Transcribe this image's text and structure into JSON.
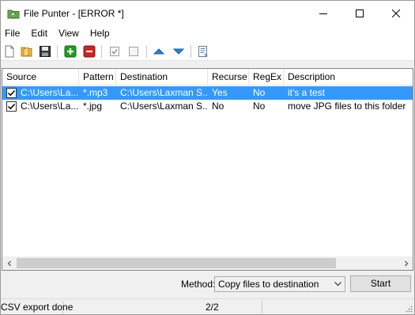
{
  "window": {
    "title": "File Punter - [ERROR *]"
  },
  "menu": {
    "items": [
      "File",
      "Edit",
      "View",
      "Help"
    ]
  },
  "toolbar": {
    "icons": [
      "new-icon",
      "open-icon",
      "save-icon",
      "add-icon",
      "remove-icon",
      "check-all-icon",
      "uncheck-all-icon",
      "move-up-icon",
      "move-down-icon",
      "export-icon"
    ]
  },
  "list": {
    "columns": [
      "Source",
      "Pattern",
      "Destination",
      "Recurse",
      "RegEx",
      "Description"
    ],
    "rows": [
      {
        "checked": true,
        "selected": true,
        "source": "C:\\Users\\La...",
        "pattern": "*.mp3",
        "destination": "C:\\Users\\Laxman S...",
        "recurse": "Yes",
        "regex": "No",
        "description": "it's a test"
      },
      {
        "checked": true,
        "selected": false,
        "source": "C:\\Users\\La...",
        "pattern": "*.jpg",
        "destination": "C:\\Users\\Laxman S...",
        "recurse": "No",
        "regex": "No",
        "description": "move JPG files to this folder"
      }
    ]
  },
  "controls": {
    "method_label": "Method:",
    "method_value": "Copy files to destination",
    "start_label": "Start"
  },
  "status": {
    "message": "CSV export done",
    "count": "2/2"
  },
  "colors": {
    "selection": "#3399ff",
    "add_green": "#1e9e1e",
    "remove_red": "#d02020",
    "arrow_blue": "#2a7fd4"
  }
}
